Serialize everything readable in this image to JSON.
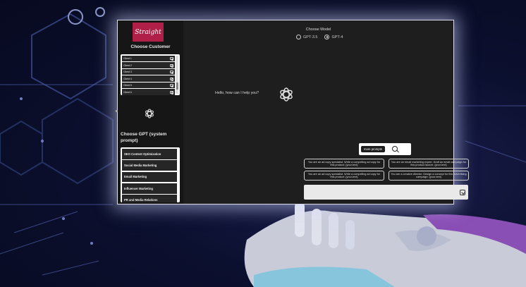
{
  "brand": {
    "logo_text": "Straight",
    "accent_color": "#b01f48"
  },
  "sidebar": {
    "customer_title": "Choose Customer",
    "customers": [
      "Client 1",
      "Client 2",
      "Client 3",
      "Client 4",
      "Client 5",
      "Client 6"
    ],
    "customer_item_icon": "camera-icon",
    "gpt_title": "Choose GPT (system prompt)",
    "gpt_prompts": [
      "SEO Content Optimization",
      "Social Media Marketing",
      "Email Marketing",
      "Influencer Marketing",
      "PR and Media Relations"
    ]
  },
  "model": {
    "title": "Choose Model",
    "options": [
      {
        "label": "GPT-3.5",
        "selected": false
      },
      {
        "label": "GPT-4",
        "selected": true
      }
    ]
  },
  "chat": {
    "greeting": "Hello, how can I help you?",
    "more_prompts_label": "more prompts",
    "suggestions": [
      "You are an ad copy specialist. Write a compelling ad copy for this product: {your-text}",
      "You are an email marketing expert. Draft an email campaign for this product launch: {your-text}",
      "You are an ad copy specialist. Write a compelling ad copy for this product: {your-text}",
      "You are a creative director. Design a concept for this advertising campaign: {your-text}"
    ],
    "input_value": "",
    "send_icon": "send-icon"
  }
}
